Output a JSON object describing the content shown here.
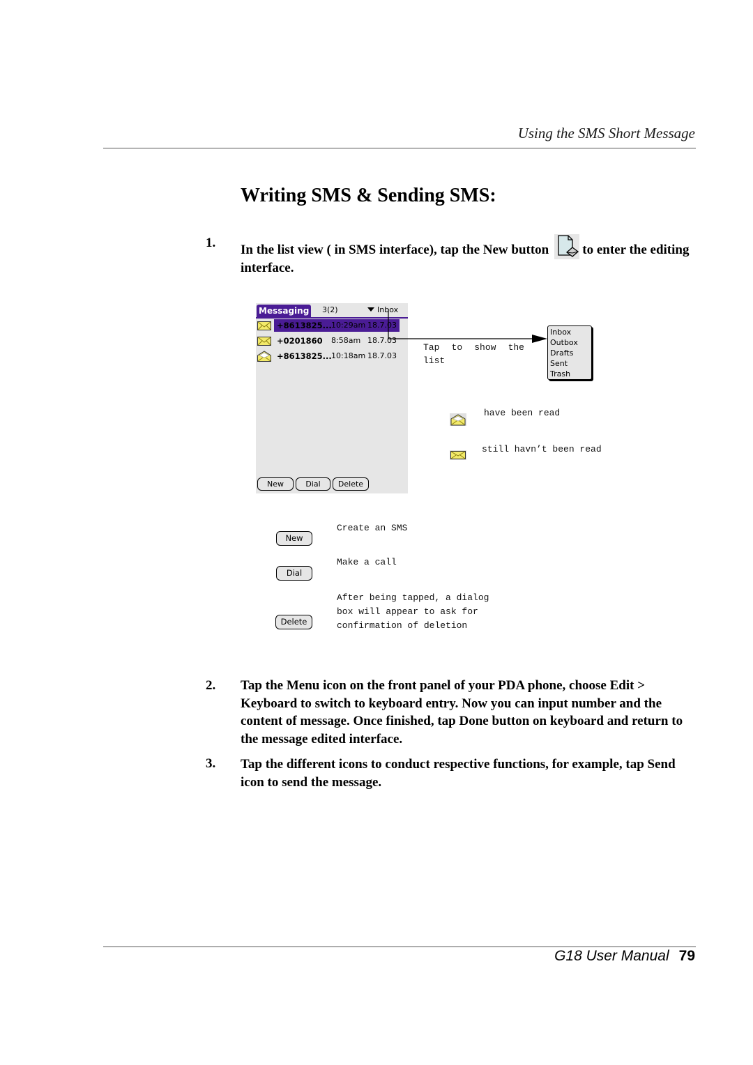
{
  "header": {
    "running_title": "Using the SMS Short Message"
  },
  "title": "Writing SMS & Sending SMS:",
  "steps": [
    {
      "number": "1.",
      "text_before_icon": "In the list view ( in SMS interface), tap the New button",
      "icon": "new-message-icon",
      "text_after_icon": "to enter the editing interface."
    },
    {
      "number": "2.",
      "text": "Tap the Menu icon  on the front panel of your PDA phone, choose Edit > Keyboard to switch to keyboard entry. Now you can input number and the content of message. Once finished, tap Done button on keyboard and return to the message edited interface."
    },
    {
      "number": "3.",
      "text": "Tap the different icons to conduct respective functions, for example, tap Send icon to send the message."
    }
  ],
  "pda": {
    "app_title": "Messaging",
    "count": "3(2)",
    "category": "Inbox",
    "messages": [
      {
        "number": "+8613825...",
        "time": "10:29am",
        "date": "18.7.03",
        "icon": "unread-envelope-icon",
        "selected": true
      },
      {
        "number": "+0201860",
        "time": "8:58am",
        "date": "18.7.03",
        "icon": "unread-envelope-icon",
        "selected": false
      },
      {
        "number": "+8613825...",
        "time": "10:18am",
        "date": "18.7.03",
        "icon": "read-envelope-icon",
        "selected": false
      }
    ],
    "buttons": [
      "New",
      "Dial",
      "Delete"
    ],
    "accent_color": "#4a1c95"
  },
  "category_popup": {
    "items": [
      "Inbox",
      "Outbox",
      "Drafts",
      "Sent",
      "Trash"
    ]
  },
  "annotations": {
    "tap_note": "Tap to show the list",
    "read_legend": "have been read",
    "unread_legend": "still havn’t been read"
  },
  "button_legend": [
    {
      "label": "New",
      "description": "Create an SMS"
    },
    {
      "label": "Dial",
      "description": "Make a call"
    },
    {
      "label": "Delete",
      "description": "After being tapped, a dialog box will appear to ask for confirmation of deletion"
    }
  ],
  "footer": {
    "manual": "G18 User Manual",
    "page": "79"
  }
}
